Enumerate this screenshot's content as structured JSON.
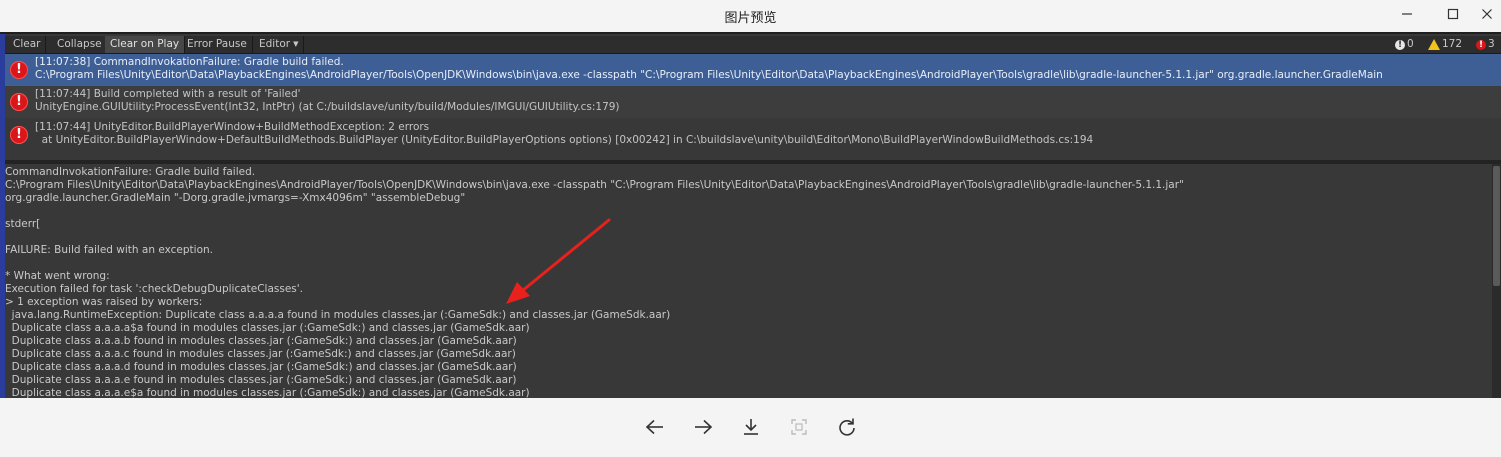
{
  "window": {
    "title": "图片预览"
  },
  "toolbar": {
    "buttons": [
      {
        "label": "Clear",
        "active": false
      },
      {
        "label": "Collapse",
        "active": false
      },
      {
        "label": "Clear on Play",
        "active": true
      },
      {
        "label": "Error Pause",
        "active": false
      },
      {
        "label": "Editor",
        "active": false
      }
    ],
    "counts": {
      "info": "0",
      "warnings": "172",
      "errors": "3"
    }
  },
  "entries": [
    {
      "line1": "[11:07:38] CommandInvokationFailure: Gradle build failed.",
      "line2": "C:\\Program Files\\Unity\\Editor\\Data\\PlaybackEngines\\AndroidPlayer/Tools\\OpenJDK\\Windows\\bin\\java.exe -classpath \"C:\\Program Files\\Unity\\Editor\\Data\\PlaybackEngines\\AndroidPlayer\\Tools\\gradle\\lib\\gradle-launcher-5.1.1.jar\" org.gradle.launcher.GradleMain",
      "selected": true
    },
    {
      "line1": "[11:07:44] Build completed with a result of 'Failed'",
      "line2": "UnityEngine.GUIUtility:ProcessEvent(Int32, IntPtr) (at C:/buildslave/unity/build/Modules/IMGUI/GUIUtility.cs:179)",
      "selected": false
    },
    {
      "line1": "[11:07:44] UnityEditor.BuildPlayerWindow+BuildMethodException: 2 errors",
      "line2": "  at UnityEditor.BuildPlayerWindow+DefaultBuildMethods.BuildPlayer (UnityEditor.BuildPlayerOptions options) [0x00242] in C:\\buildslave\\unity\\build\\Editor\\Mono\\BuildPlayerWindowBuildMethods.cs:194",
      "selected": false
    }
  ],
  "detail": {
    "lines": [
      "CommandInvokationFailure: Gradle build failed.",
      "C:\\Program Files\\Unity\\Editor\\Data\\PlaybackEngines\\AndroidPlayer/Tools\\OpenJDK\\Windows\\bin\\java.exe -classpath \"C:\\Program Files\\Unity\\Editor\\Data\\PlaybackEngines\\AndroidPlayer\\Tools\\gradle\\lib\\gradle-launcher-5.1.1.jar\"",
      "org.gradle.launcher.GradleMain \"-Dorg.gradle.jvmargs=-Xmx4096m\" \"assembleDebug\"",
      "",
      "stderr[",
      "",
      "FAILURE: Build failed with an exception.",
      "",
      "* What went wrong:",
      "Execution failed for task ':checkDebugDuplicateClasses'.",
      "> 1 exception was raised by workers:",
      "  java.lang.RuntimeException: Duplicate class a.a.a.a found in modules classes.jar (:GameSdk:) and classes.jar (GameSdk.aar)",
      "  Duplicate class a.a.a.a$a found in modules classes.jar (:GameSdk:) and classes.jar (GameSdk.aar)",
      "  Duplicate class a.a.a.b found in modules classes.jar (:GameSdk:) and classes.jar (GameSdk.aar)",
      "  Duplicate class a.a.a.c found in modules classes.jar (:GameSdk:) and classes.jar (GameSdk.aar)",
      "  Duplicate class a.a.a.d found in modules classes.jar (:GameSdk:) and classes.jar (GameSdk.aar)",
      "  Duplicate class a.a.a.e found in modules classes.jar (:GameSdk:) and classes.jar (GameSdk.aar)",
      "  Duplicate class a.a.a.e$a found in modules classes.jar (:GameSdk:) and classes.jar (GameSdk.aar)"
    ]
  },
  "viewer": {
    "controls": [
      "arrow-left-icon",
      "arrow-right-icon",
      "download-icon",
      "fit-screen-icon",
      "rotate-icon"
    ]
  },
  "colors": {
    "selected_row": "#3e5f96",
    "console_bg": "#383838",
    "error_red": "#d9161a",
    "annotation_arrow": "#e8211d"
  }
}
